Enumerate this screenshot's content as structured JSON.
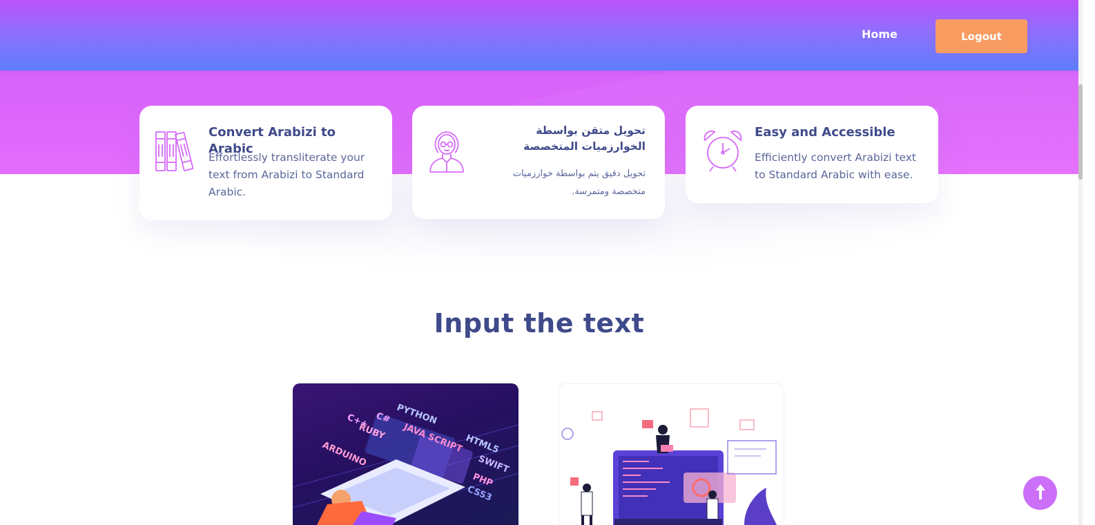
{
  "nav": {
    "home_label": "Home",
    "logout_label": "Logout"
  },
  "features": [
    {
      "icon": "books-icon",
      "title": "Convert Arabizi to Arabic",
      "description": "Effortlessly transliterate your text from Arabizi to Standard Arabic."
    },
    {
      "icon": "woman-avatar-icon",
      "title": "تحويل متقن بواسطة الخوارزميات المتخصصة",
      "description": "تحويل دقيق يتم بواسطة خوارزميات متخصصة ومتمرسة."
    },
    {
      "icon": "alarm-clock-icon",
      "title": "Easy and Accessible",
      "description": "Efficiently convert Arabizi text to Standard Arabic with ease."
    }
  ],
  "section": {
    "title": "Input the text"
  },
  "thumbnails": {
    "first": {
      "labels": [
        "C#",
        "PYTHON",
        "C++",
        "RUBY",
        "JAVA SCRIPT",
        "HTML5",
        "ARDUINO",
        "SWIFT",
        "PHP",
        "CSS3"
      ]
    }
  },
  "colors": {
    "hero": "#e46cfd",
    "nav_top": "#bb52fb",
    "nav_bottom": "#5d7dfc",
    "logout_button": "#f99c62",
    "heading_text": "#3f4a8a",
    "icon_stroke": "#d56af8",
    "to_top_button": "#cc6ff9"
  }
}
